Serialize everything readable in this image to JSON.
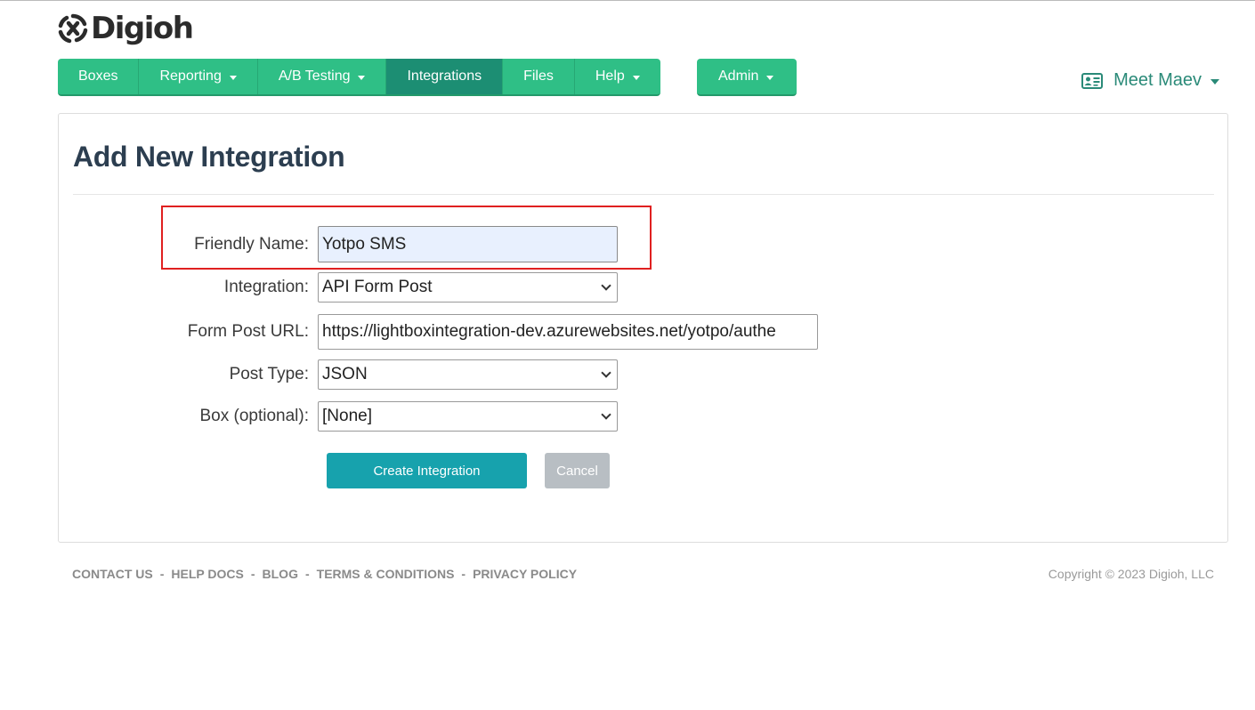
{
  "logo": {
    "text": "Digioh",
    "icon": "digioh-logo-icon"
  },
  "nav": {
    "items": [
      {
        "label": "Boxes"
      },
      {
        "label": "Reporting"
      },
      {
        "label": "A/B Testing"
      },
      {
        "label": "Integrations"
      },
      {
        "label": "Files"
      },
      {
        "label": "Help"
      }
    ],
    "admin_label": "Admin",
    "active": "Integrations"
  },
  "user": {
    "name": "Meet Maev",
    "icon": "contact-card-icon"
  },
  "page": {
    "title": "Add New Integration"
  },
  "form": {
    "friendly_name": {
      "label": "Friendly Name:",
      "value": "Yotpo SMS"
    },
    "integration": {
      "label": "Integration:",
      "value": "API Form Post"
    },
    "form_post_url": {
      "label": "Form Post URL:",
      "value": "https://lightboxintegration-dev.azurewebsites.net/yotpo/authe"
    },
    "post_type": {
      "label": "Post Type:",
      "value": "JSON"
    },
    "box": {
      "label": "Box (optional):",
      "value": "[None]"
    },
    "create_label": "Create Integration",
    "cancel_label": "Cancel"
  },
  "footer": {
    "links": [
      "CONTACT US",
      "HELP DOCS",
      "BLOG",
      "TERMS & CONDITIONS",
      "PRIVACY POLICY"
    ],
    "separator": "-",
    "copyright": "Copyright © 2023 Digioh, LLC"
  },
  "colors": {
    "nav_green": "#2fbf86",
    "nav_active": "#1c8e73",
    "primary_button": "#17a2ad",
    "cancel_button": "#b8bec3",
    "highlight": "#e02020"
  }
}
